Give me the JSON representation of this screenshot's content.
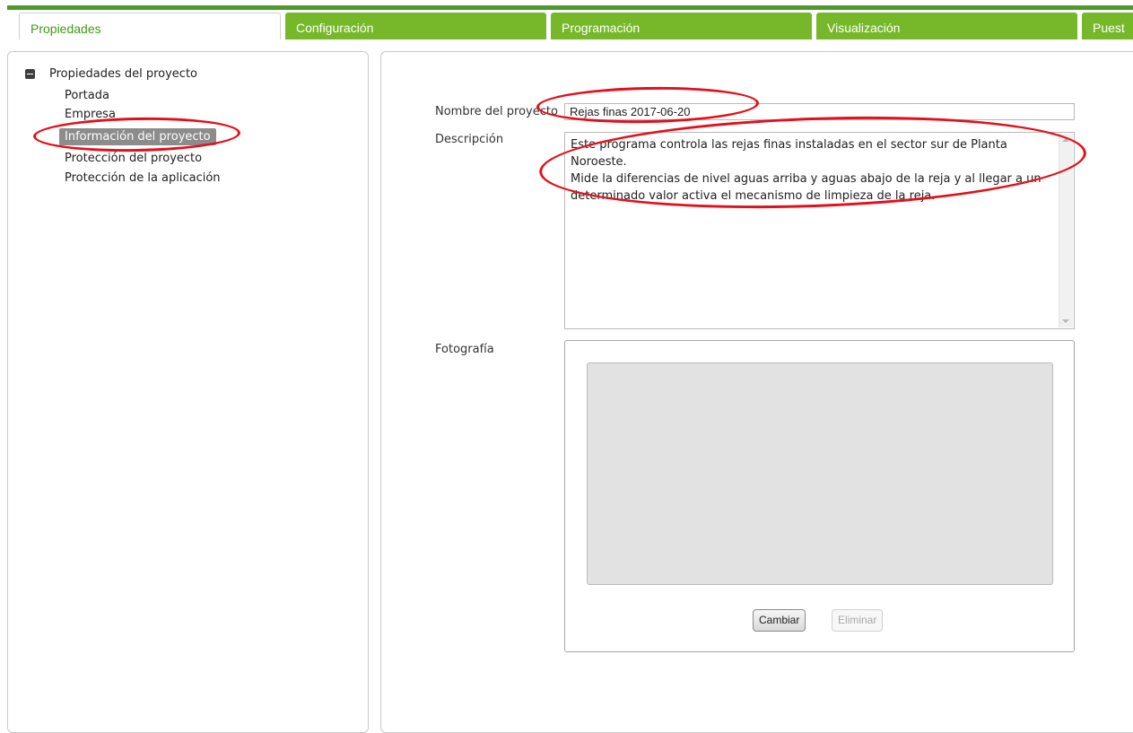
{
  "tabs": [
    {
      "label": "Propiedades",
      "active": true
    },
    {
      "label": "Configuración",
      "active": false
    },
    {
      "label": "Programación",
      "active": false
    },
    {
      "label": "Visualización",
      "active": false
    },
    {
      "label": "Puest",
      "active": false
    }
  ],
  "tree": {
    "root_label": "Propiedades del proyecto",
    "items": [
      {
        "label": "Portada",
        "selected": false
      },
      {
        "label": "Empresa",
        "selected": false
      },
      {
        "label": "Información del proyecto",
        "selected": true
      },
      {
        "label": "Protección del proyecto",
        "selected": false
      },
      {
        "label": "Protección de la aplicación",
        "selected": false
      }
    ]
  },
  "form": {
    "name_label": "Nombre del proyecto",
    "name_value": "Rejas finas 2017-06-20",
    "description_label": "Descripción",
    "description_lines": [
      "Este programa controla las rejas finas instaladas en el sector sur de Planta Noroeste.",
      "Mide la diferencias de nivel aguas arriba y aguas abajo de la reja y al llegar a un",
      "determinado valor activa el mecanismo de limpieza de la reja."
    ],
    "photo_label": "Fotografía",
    "change_button": "Cambiar",
    "delete_button": "Eliminar"
  },
  "colors": {
    "tab_green": "#76b82a",
    "active_tab_text": "#3f9b16",
    "selection_gray": "#8c8c8c",
    "annotation_red": "#e3101b"
  }
}
